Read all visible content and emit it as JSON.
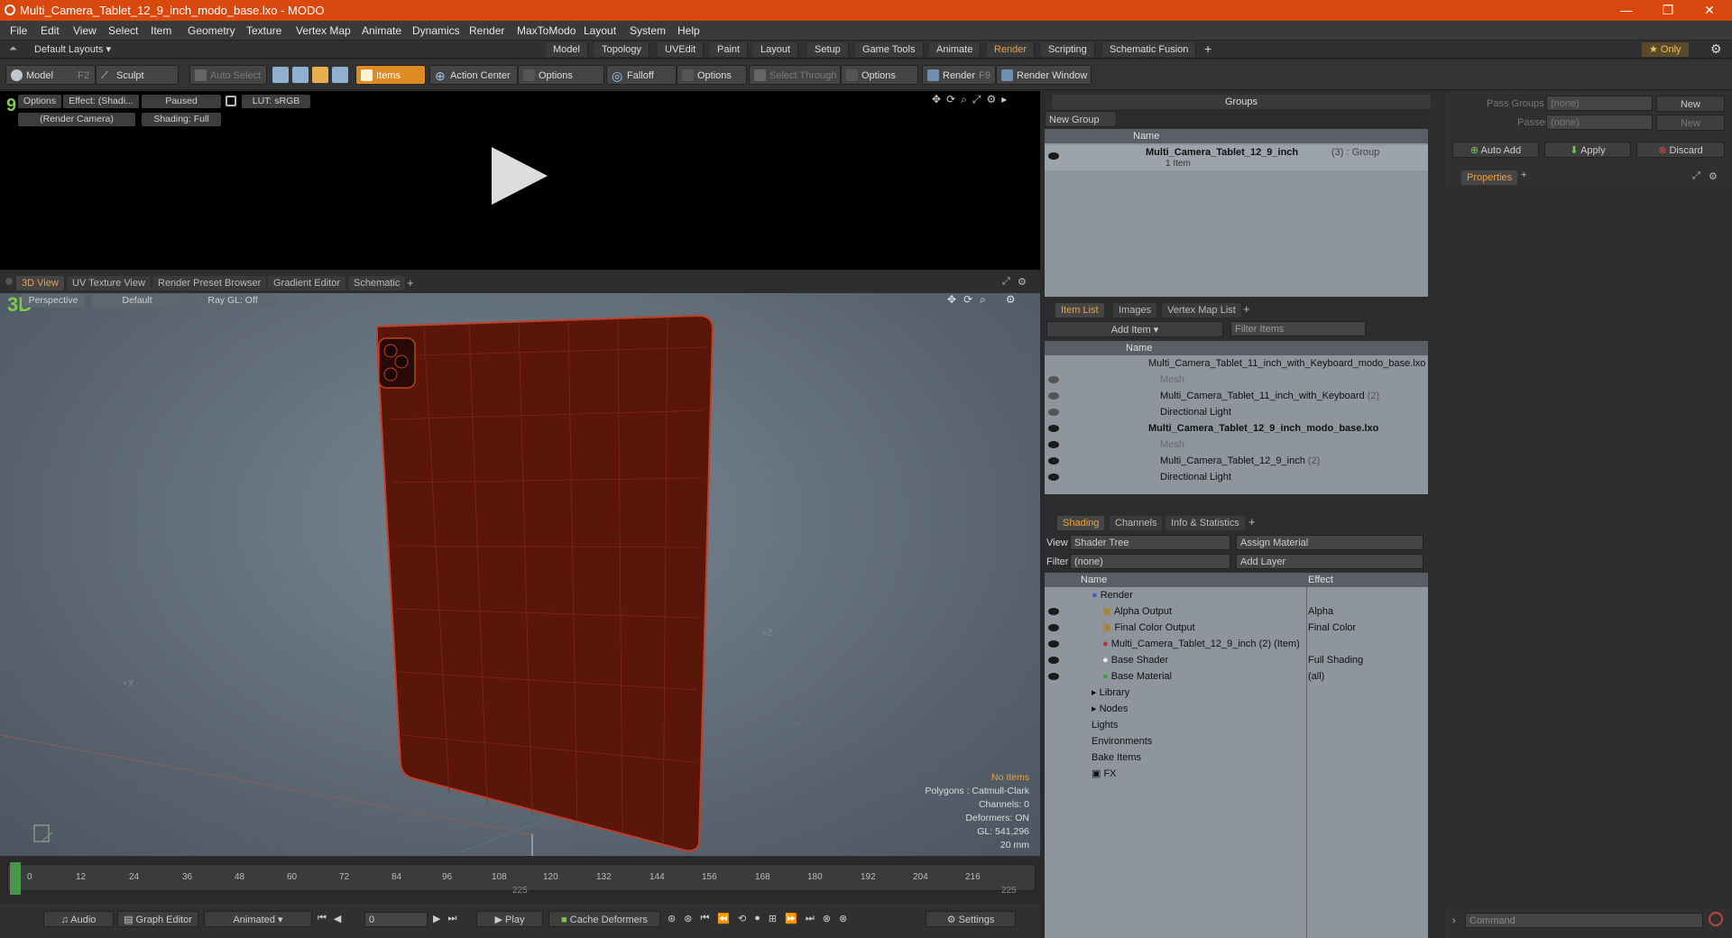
{
  "window": {
    "title": "Multi_Camera_Tablet_12_9_inch_modo_base.lxo - MODO",
    "minimize": "—",
    "restore": "❐",
    "close": "✕"
  },
  "menu": [
    "File",
    "Edit",
    "View",
    "Select",
    "Item",
    "Geometry",
    "Texture",
    "Vertex Map",
    "Animate",
    "Dynamics",
    "Render",
    "MaxToModo",
    "Layout",
    "System",
    "Help"
  ],
  "layoutbar": {
    "layout_label": "Default Layouts ▾",
    "tabs": [
      "Model",
      "Topology",
      "UVEdit",
      "Paint",
      "Layout",
      "Setup",
      "Game Tools",
      "Animate",
      "Render",
      "Scripting",
      "Schematic Fusion",
      "+"
    ],
    "active_tab": "Render",
    "only_label": "★  Only"
  },
  "toolbar": {
    "model": "Model",
    "model_key": "F2",
    "sculpt": "Sculpt",
    "auto_select": "Auto Select",
    "items": "Items",
    "action_center": "Action Center",
    "options1": "Options",
    "falloff": "Falloff",
    "options2": "Options",
    "select_through": "Select Through",
    "options3": "Options",
    "render": "Render",
    "render_key": "F9",
    "render_window": "Render Window"
  },
  "render_view": {
    "options": "Options",
    "effect": "Effect: (Shadi...",
    "paused": "Paused",
    "lut": "LUT: sRGB",
    "camera": "(Render Camera)",
    "shading": "Shading: Full"
  },
  "viewport_tabs": [
    "3D View",
    "UV Texture View",
    "Render Preset Browser",
    "Gradient Editor",
    "Schematic",
    "+"
  ],
  "viewport": {
    "perspective": "Perspective",
    "default": "Default",
    "raygl": "Ray GL: Off",
    "no_items": "No Items",
    "polygons": "Polygons : Catmull-Clark",
    "channels": "Channels: 0",
    "deformers": "Deformers: ON",
    "gl": "GL: 541,296",
    "size": "20 mm",
    "axis_x": "+X",
    "axis_z": "+Z"
  },
  "groups": {
    "title": "Groups",
    "new_group": "New Group",
    "col_name": "Name",
    "row_name": "Multi_Camera_Tablet_12_9_inch",
    "row_count": "(3) : Group",
    "row_sub": "1 Item"
  },
  "item_list": {
    "tabs": [
      "Item List",
      "Images",
      "Vertex Map List",
      "+"
    ],
    "add_item": "Add Item",
    "filter": "Filter Items",
    "col_name": "Name",
    "rows": [
      {
        "label": "Multi_Camera_Tablet_11_inch_with_Keyboard_modo_base.lxo",
        "extra": "",
        "bold": false,
        "dim": false
      },
      {
        "label": "Mesh",
        "extra": "",
        "bold": false,
        "dim": true
      },
      {
        "label": "Multi_Camera_Tablet_11_inch_with_Keyboard",
        "extra": "(2)",
        "bold": false,
        "dim": false
      },
      {
        "label": "Directional Light",
        "extra": "",
        "bold": false,
        "dim": false
      },
      {
        "label": "Multi_Camera_Tablet_12_9_inch_modo_base.lxo",
        "extra": "",
        "bold": true,
        "dim": false
      },
      {
        "label": "Mesh",
        "extra": "",
        "bold": false,
        "dim": true
      },
      {
        "label": "Multi_Camera_Tablet_12_9_inch",
        "extra": "(2)",
        "bold": false,
        "dim": false
      },
      {
        "label": "Directional Light",
        "extra": "",
        "bold": false,
        "dim": false
      }
    ]
  },
  "shading": {
    "tabs": [
      "Shading",
      "Channels",
      "Info & Statistics",
      "+"
    ],
    "view_label": "View",
    "view_value": "Shader Tree",
    "assign_material": "Assign Material",
    "filter_label": "Filter",
    "filter_value": "(none)",
    "add_layer": "Add Layer",
    "col_name": "Name",
    "col_effect": "Effect",
    "rows": [
      {
        "label": "Render",
        "effect": ""
      },
      {
        "label": "Alpha Output",
        "effect": "Alpha"
      },
      {
        "label": "Final Color Output",
        "effect": "Final Color"
      },
      {
        "label": "Multi_Camera_Tablet_12_9_inch (2) (Item)",
        "effect": ""
      },
      {
        "label": "Base Shader",
        "effect": "Full Shading"
      },
      {
        "label": "Base Material",
        "effect": "(all)"
      },
      {
        "label": "Library",
        "effect": ""
      },
      {
        "label": "Nodes",
        "effect": ""
      },
      {
        "label": "Lights",
        "effect": ""
      },
      {
        "label": "Environments",
        "effect": ""
      },
      {
        "label": "Bake Items",
        "effect": ""
      },
      {
        "label": "FX",
        "effect": ""
      }
    ]
  },
  "properties": {
    "pass_groups": "Pass Groups",
    "passes": "Passes",
    "none1": "(none)",
    "none2": "(none)",
    "new1": "New",
    "new2": "New",
    "auto_add": "Auto Add",
    "apply": "Apply",
    "discard": "Discard",
    "tab": "Properties",
    "command": "Command"
  },
  "timeline": {
    "ticks": [
      "0",
      "12",
      "24",
      "36",
      "48",
      "60",
      "72",
      "84",
      "96",
      "108",
      "120",
      "132",
      "144",
      "156",
      "168",
      "180",
      "192",
      "204",
      "216"
    ],
    "end1": "225",
    "end2": "225"
  },
  "bottom": {
    "audio": "Audio",
    "graph_editor": "Graph Editor",
    "animated": "Animated",
    "frame": "0",
    "play": "Play",
    "cache": "Cache Deformers",
    "settings": "Settings"
  },
  "colors": {
    "accent": "#f0a040",
    "title": "#d9480f",
    "tablet": "#5a1608",
    "wire": "#c0402a"
  }
}
